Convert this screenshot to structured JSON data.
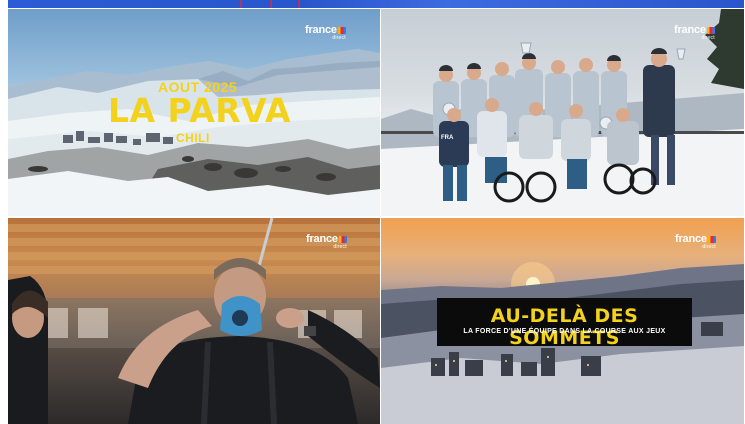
{
  "tiles": [
    {
      "id": "tile-1",
      "brand": {
        "name": "france",
        "sub": "direct"
      },
      "overlay": {
        "line1": "AOUT 2025",
        "line2": "LA PARVA",
        "line3": "CHILI"
      }
    },
    {
      "id": "tile-2",
      "brand": {
        "name": "france",
        "sub": "direct"
      },
      "jersey_text": "FRA"
    },
    {
      "id": "tile-3",
      "brand": {
        "name": "france",
        "sub": "direct"
      }
    },
    {
      "id": "tile-4",
      "brand": {
        "name": "france",
        "sub": "direct"
      },
      "overlay": {
        "title": "AU-DELÀ DES SOMMETS",
        "subtitle": "LA FORCE D'UNE ÉQUIPE DANS LA COURSE AUX JEUX"
      }
    }
  ],
  "colors": {
    "title_yellow": "#f3d21d",
    "top_strip_blue": "#2b5bd6",
    "title_box_black": "#0b0b0b"
  }
}
